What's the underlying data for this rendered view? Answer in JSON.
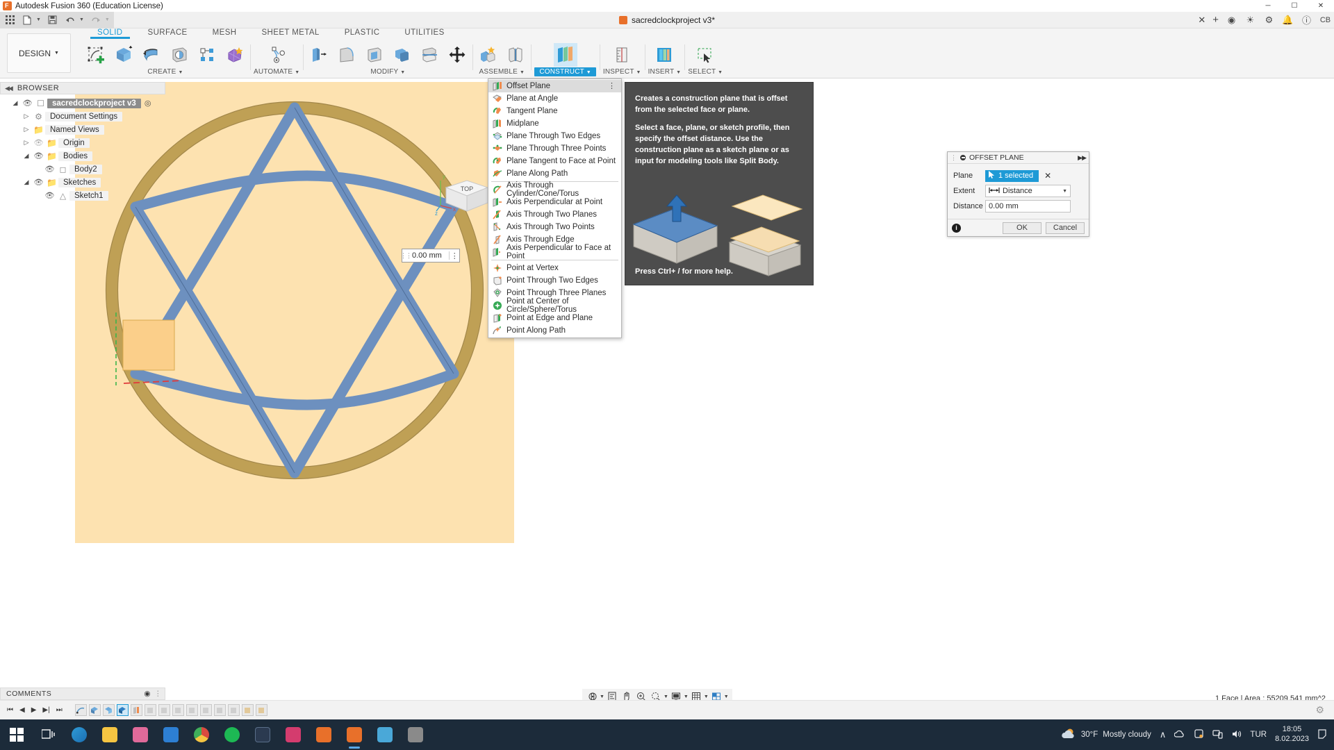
{
  "window": {
    "title": "Autodesk Fusion 360 (Education License)",
    "app_icon": "fusion-logo-icon",
    "minimize": "─",
    "maximize": "☐",
    "close": "✕"
  },
  "quick_access": {
    "grid_icon": "app-grid-icon",
    "new_icon": "new-file-icon",
    "save_icon": "save-icon",
    "undo_icon": "undo-icon",
    "redo_icon": "redo-icon",
    "document_tab": "sacredclockproject v3*",
    "tab_close": "✕",
    "new_tab": "+",
    "right_icons": [
      "extensions-icon",
      "help-circle-icon",
      "job-status-icon",
      "notifications-bell-icon",
      "help-icon"
    ],
    "account_initials": "CB"
  },
  "ribbon": {
    "design_dropdown": "DESIGN",
    "tabs": [
      {
        "label": "SOLID",
        "active": true
      },
      {
        "label": "SURFACE",
        "active": false
      },
      {
        "label": "MESH",
        "active": false
      },
      {
        "label": "SHEET METAL",
        "active": false
      },
      {
        "label": "PLASTIC",
        "active": false
      },
      {
        "label": "UTILITIES",
        "active": false
      }
    ],
    "panels": [
      {
        "label": "CREATE",
        "dropdown": true
      },
      {
        "label": "AUTOMATE",
        "dropdown": true
      },
      {
        "label": "MODIFY",
        "dropdown": true
      },
      {
        "label": "ASSEMBLE",
        "dropdown": true
      },
      {
        "label": "CONSTRUCT",
        "dropdown": true,
        "active": true
      },
      {
        "label": "INSPECT",
        "dropdown": true
      },
      {
        "label": "INSERT",
        "dropdown": true
      },
      {
        "label": "SELECT",
        "dropdown": true
      }
    ]
  },
  "browser": {
    "title": "BROWSER",
    "collapse_icon": "collapse-left-icon",
    "items": [
      {
        "label": "sacredclockproject v3",
        "indent": 0,
        "arrow": "expanded",
        "eye": "visible",
        "icon": "document-icon",
        "selected": true,
        "end_icon": "radio-target-icon"
      },
      {
        "label": "Document Settings",
        "indent": 1,
        "arrow": "collapsed",
        "eye": "none",
        "icon": "gear-icon",
        "selected": false
      },
      {
        "label": "Named Views",
        "indent": 1,
        "arrow": "collapsed",
        "eye": "none",
        "icon": "folder-icon",
        "selected": false
      },
      {
        "label": "Origin",
        "indent": 1,
        "arrow": "collapsed",
        "eye": "hidden",
        "icon": "folder-icon",
        "selected": false
      },
      {
        "label": "Bodies",
        "indent": 1,
        "arrow": "expanded",
        "eye": "visible",
        "icon": "folder-icon",
        "selected": false
      },
      {
        "label": "Body2",
        "indent": 2,
        "arrow": "none",
        "eye": "visible",
        "icon": "body-icon",
        "selected": false
      },
      {
        "label": "Sketches",
        "indent": 1,
        "arrow": "expanded",
        "eye": "visible",
        "icon": "folder-icon",
        "selected": false
      },
      {
        "label": "Sketch1",
        "indent": 2,
        "arrow": "none",
        "eye": "visible",
        "icon": "sketch-icon",
        "selected": false
      }
    ]
  },
  "construct_menu": {
    "items": [
      {
        "label": "Offset Plane",
        "icon": "offset-plane-icon",
        "highlighted": true,
        "overflow": "⋮"
      },
      {
        "label": "Plane at Angle",
        "icon": "plane-at-angle-icon"
      },
      {
        "label": "Tangent Plane",
        "icon": "tangent-plane-icon"
      },
      {
        "label": "Midplane",
        "icon": "midplane-icon"
      },
      {
        "label": "Plane Through Two Edges",
        "icon": "plane-two-edges-icon"
      },
      {
        "label": "Plane Through Three Points",
        "icon": "plane-three-points-icon"
      },
      {
        "label": "Plane Tangent to Face at Point",
        "icon": "plane-tangent-face-point-icon"
      },
      {
        "label": "Plane Along Path",
        "icon": "plane-along-path-icon"
      },
      {
        "separator": true
      },
      {
        "label": "Axis Through Cylinder/Cone/Torus",
        "icon": "axis-cylinder-icon"
      },
      {
        "label": "Axis Perpendicular at Point",
        "icon": "axis-perpendicular-point-icon"
      },
      {
        "label": "Axis Through Two Planes",
        "icon": "axis-two-planes-icon"
      },
      {
        "label": "Axis Through Two Points",
        "icon": "axis-two-points-icon"
      },
      {
        "label": "Axis Through Edge",
        "icon": "axis-through-edge-icon"
      },
      {
        "label": "Axis Perpendicular to Face at Point",
        "icon": "axis-perpendicular-face-icon"
      },
      {
        "separator": true
      },
      {
        "label": "Point at Vertex",
        "icon": "point-vertex-icon"
      },
      {
        "label": "Point Through Two Edges",
        "icon": "point-two-edges-icon"
      },
      {
        "label": "Point Through Three Planes",
        "icon": "point-three-planes-icon"
      },
      {
        "label": "Point at Center of Circle/Sphere/Torus",
        "icon": "point-center-circle-icon"
      },
      {
        "label": "Point at Edge and Plane",
        "icon": "point-edge-plane-icon"
      },
      {
        "label": "Point Along Path",
        "icon": "point-along-path-icon"
      }
    ]
  },
  "tooltip": {
    "paragraph1": "Creates a construction plane that is offset from the selected face or plane.",
    "paragraph2": "Select a face, plane, or sketch profile, then specify the offset distance. Use the construction plane as a sketch plane or as input for modeling tools like Split Body.",
    "hint": "Press Ctrl+ / for more help."
  },
  "offset_plane_dialog": {
    "title": "OFFSET PLANE",
    "expand_icon": "▶▶",
    "rows": [
      {
        "label": "Plane",
        "type": "selection",
        "value": "1 selected",
        "clear": "✕",
        "cursor_icon": "select-cursor-icon"
      },
      {
        "label": "Extent",
        "type": "combo",
        "value": "Distance",
        "icon": "distance-icon"
      },
      {
        "label": "Distance",
        "type": "input",
        "value": "0.00 mm"
      }
    ],
    "info_icon": "info-icon",
    "ok": "OK",
    "cancel": "Cancel"
  },
  "canvas": {
    "distance_manipulator": {
      "value": "0.00 mm",
      "grip_icon": "drag-grip-icon",
      "menu_icon": "⋮"
    },
    "viewcube": {
      "face": "TOP",
      "axis_x": "x",
      "axis_y": "y",
      "axis_z": "z"
    },
    "colors": {
      "background": "#fde2b0",
      "body_fill": "#fde2b0",
      "ring": "#bfa055",
      "star": "#6d90bf",
      "selected_face": "#fbcf8a"
    }
  },
  "comments": {
    "title": "COMMENTS",
    "expand_icon": "expand-icon"
  },
  "navbar": {
    "items": [
      "orbit-icon",
      "look-at-icon",
      "pan-icon",
      "zoom-icon",
      "display-settings-icon",
      "grid-snap-icon",
      "viewports-icon"
    ]
  },
  "status_bar": {
    "text": "1 Face | Area : 55209.541 mm^2"
  },
  "timeline": {
    "nav": [
      "skip-start-icon",
      "step-back-icon",
      "play-icon",
      "step-forward-icon",
      "skip-end-icon"
    ],
    "features": [
      {
        "icon": "sketch-feature-icon",
        "active": false
      },
      {
        "icon": "extrude-feature-icon",
        "active": false
      },
      {
        "icon": "extrude-feature-icon",
        "active": false
      },
      {
        "icon": "extrude-feature-icon",
        "active": true
      },
      {
        "icon": "construct-feature-icon",
        "active": false
      },
      {
        "icon": "feature-icon",
        "active": false
      },
      {
        "icon": "feature-icon",
        "active": false
      },
      {
        "icon": "feature-icon",
        "active": false
      },
      {
        "icon": "feature-icon",
        "active": false
      },
      {
        "icon": "feature-icon",
        "active": false
      },
      {
        "icon": "feature-icon",
        "active": false
      },
      {
        "icon": "feature-icon",
        "active": false
      },
      {
        "icon": "feature-icon",
        "active": false
      },
      {
        "icon": "feature-icon",
        "active": false
      }
    ],
    "settings_icon": "gear-icon"
  },
  "taskbar": {
    "start_icon": "windows-start-icon",
    "search_icon": "task-view-icon",
    "apps": [
      {
        "name": "edge-icon",
        "color": "#2f9bd6",
        "running": false
      },
      {
        "name": "file-explorer-icon",
        "color": "#f5c542",
        "running": false
      },
      {
        "name": "store-icon",
        "color": "#e06a9a",
        "running": false
      },
      {
        "name": "mail-icon",
        "color": "#2d7fd3",
        "running": false
      },
      {
        "name": "chrome-icon",
        "color": "#d94b3f",
        "running": false
      },
      {
        "name": "spotify-icon",
        "color": "#1db954",
        "running": false
      },
      {
        "name": "btt-icon",
        "color": "#2b3a50",
        "running": false
      },
      {
        "name": "monitor-app-icon",
        "color": "#d43c6e",
        "running": false
      },
      {
        "name": "creative-cloud-icon",
        "color": "#e8702a",
        "running": false
      },
      {
        "name": "fusion360-icon",
        "color": "#e8702a",
        "running": true
      },
      {
        "name": "paint-icon",
        "color": "#4aa8d8",
        "running": false
      },
      {
        "name": "snip-sketch-icon",
        "color": "#8a8a8a",
        "running": false
      }
    ],
    "tray": {
      "weather_icon": "cloud-icon",
      "temperature": "30°F",
      "condition": "Mostly cloudy",
      "chevron": "∧",
      "icons": [
        "onedrive-icon",
        "security-icon",
        "network-icon",
        "volume-icon"
      ],
      "language": "TUR",
      "time": "18:05",
      "date": "8.02.2023",
      "notification_icon": "notification-icon"
    }
  }
}
